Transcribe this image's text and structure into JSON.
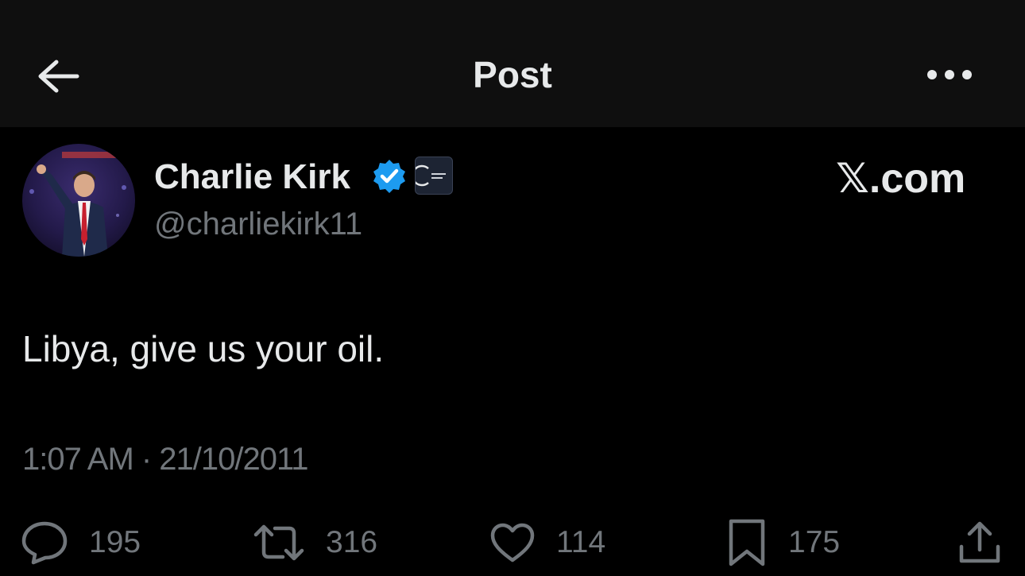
{
  "header": {
    "title": "Post",
    "back_icon": "arrow-left-icon",
    "more_icon": "more-horizontal-icon"
  },
  "author": {
    "name": "Charlie Kirk",
    "handle": "@charliekirk11",
    "verified_icon": "verified-badge-icon",
    "verified_color": "#1d9bf0",
    "affiliate_icon": "organization-affiliate-icon"
  },
  "watermark": "𝕏.com",
  "post": {
    "text": "Libya, give us your oil.",
    "timestamp": "1:07 AM · 21/10/2011"
  },
  "actions": {
    "reply": {
      "icon": "reply-icon",
      "count": "195"
    },
    "repost": {
      "icon": "repost-icon",
      "count": "316"
    },
    "like": {
      "icon": "heart-icon",
      "count": "114"
    },
    "bookmark": {
      "icon": "bookmark-icon",
      "count": "175"
    },
    "share": {
      "icon": "share-icon"
    }
  },
  "colors": {
    "background": "#000000",
    "header_background": "#0f0f0f",
    "text_primary": "#e7e9ea",
    "text_secondary": "#71767b"
  }
}
